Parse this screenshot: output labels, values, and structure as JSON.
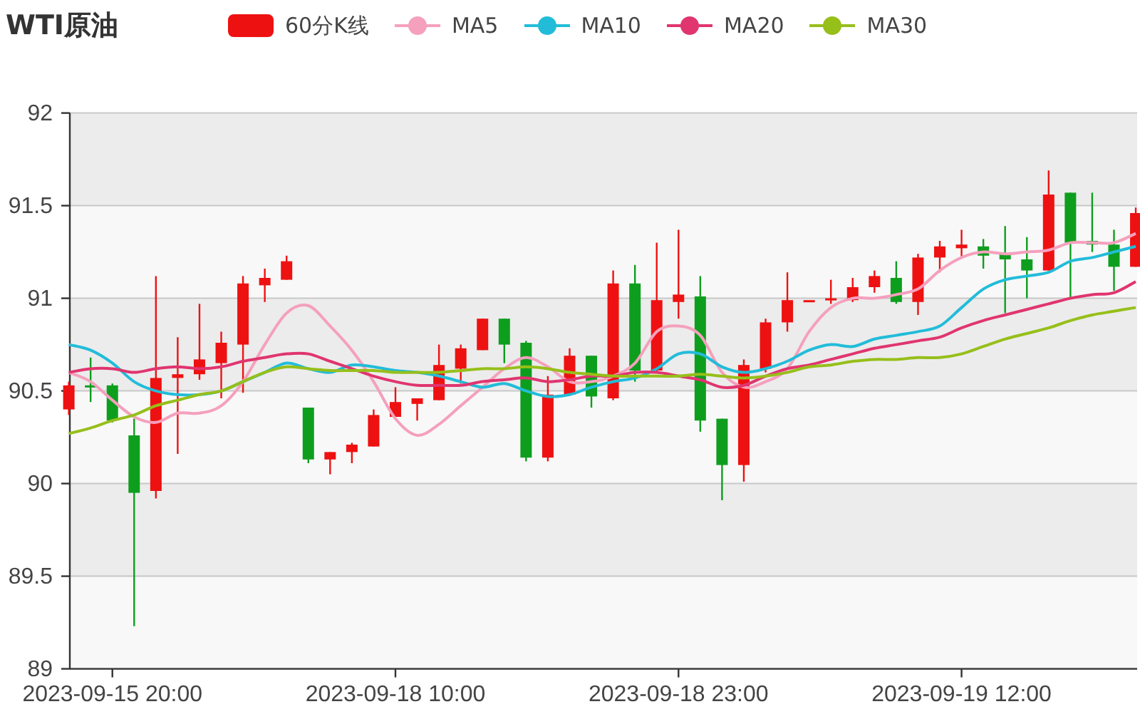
{
  "legend": {
    "candle": {
      "label": "60分K线",
      "color": "#ee1111"
    }
  },
  "chart_data": {
    "type": "candlestick",
    "title": "WTI原油",
    "grid": true,
    "ylim": [
      89,
      92
    ],
    "yticks": [
      89,
      89.5,
      90,
      90.5,
      91,
      91.5,
      92
    ],
    "categories": [
      null,
      null,
      "2023-09-15 20:00",
      null,
      null,
      null,
      null,
      null,
      null,
      null,
      null,
      null,
      null,
      null,
      null,
      "2023-09-18 10:00",
      null,
      null,
      null,
      null,
      null,
      null,
      null,
      null,
      null,
      null,
      null,
      null,
      "2023-09-18 23:00",
      null,
      null,
      null,
      null,
      null,
      null,
      null,
      null,
      null,
      null,
      null,
      null,
      "2023-09-19 12:00",
      null,
      null,
      null,
      null,
      null,
      null,
      null,
      null
    ],
    "ohlc": [
      [
        90.4,
        90.55,
        90.37,
        90.53
      ],
      [
        90.53,
        90.68,
        90.44,
        90.52
      ],
      [
        90.53,
        90.54,
        90.33,
        90.34
      ],
      [
        90.26,
        90.35,
        89.23,
        89.95
      ],
      [
        89.96,
        91.12,
        89.92,
        90.57
      ],
      [
        90.57,
        90.79,
        90.16,
        90.59
      ],
      [
        90.59,
        90.97,
        90.56,
        90.67
      ],
      [
        90.65,
        90.82,
        90.46,
        90.76
      ],
      [
        90.75,
        91.12,
        90.49,
        91.08
      ],
      [
        91.07,
        91.16,
        90.98,
        91.11
      ],
      [
        91.1,
        91.23,
        91.1,
        91.2
      ],
      [
        90.41,
        90.41,
        90.11,
        90.13
      ],
      [
        90.13,
        90.17,
        90.05,
        90.17
      ],
      [
        90.17,
        90.22,
        90.11,
        90.21
      ],
      [
        90.2,
        90.4,
        90.2,
        90.37
      ],
      [
        90.36,
        90.52,
        90.36,
        90.44
      ],
      [
        90.43,
        90.46,
        90.34,
        90.46
      ],
      [
        90.45,
        90.75,
        90.45,
        90.64
      ],
      [
        90.62,
        90.75,
        90.54,
        90.73
      ],
      [
        90.72,
        90.89,
        90.72,
        90.89
      ],
      [
        90.89,
        90.89,
        90.65,
        90.75
      ],
      [
        90.76,
        90.77,
        90.12,
        90.14
      ],
      [
        90.14,
        90.58,
        90.12,
        90.48
      ],
      [
        90.48,
        90.73,
        90.48,
        90.69
      ],
      [
        90.69,
        90.69,
        90.41,
        90.47
      ],
      [
        90.46,
        91.15,
        90.45,
        91.08
      ],
      [
        91.08,
        91.18,
        90.55,
        90.61
      ],
      [
        90.61,
        91.3,
        90.6,
        90.99
      ],
      [
        90.98,
        91.37,
        90.89,
        91.02
      ],
      [
        91.01,
        91.12,
        90.28,
        90.34
      ],
      [
        90.35,
        90.35,
        89.91,
        90.1
      ],
      [
        90.1,
        90.67,
        90.01,
        90.64
      ],
      [
        90.62,
        90.89,
        90.6,
        90.87
      ],
      [
        90.87,
        91.14,
        90.82,
        90.99
      ],
      [
        90.99,
        90.99,
        90.99,
        90.99
      ],
      [
        90.99,
        91.1,
        90.97,
        91.0
      ],
      [
        90.99,
        91.11,
        90.98,
        91.06
      ],
      [
        91.06,
        91.15,
        91.03,
        91.12
      ],
      [
        91.11,
        91.2,
        90.97,
        90.98
      ],
      [
        90.98,
        91.24,
        90.91,
        91.22
      ],
      [
        91.22,
        91.31,
        91.14,
        91.28
      ],
      [
        91.27,
        91.37,
        91.22,
        91.29
      ],
      [
        91.28,
        91.32,
        91.16,
        91.23
      ],
      [
        91.24,
        91.39,
        90.92,
        91.21
      ],
      [
        91.21,
        91.33,
        91.0,
        91.15
      ],
      [
        91.15,
        91.69,
        91.15,
        91.56
      ],
      [
        91.57,
        91.57,
        91.0,
        91.3
      ],
      [
        91.31,
        91.57,
        91.25,
        91.29
      ],
      [
        91.29,
        91.37,
        91.04,
        91.17
      ],
      [
        91.17,
        91.49,
        91.17,
        91.46
      ]
    ],
    "series": [
      {
        "name": "MA5",
        "type": "line",
        "color": "#f5a0bd",
        "values": [
          90.6,
          90.55,
          90.45,
          90.36,
          90.33,
          90.38,
          90.38,
          90.42,
          90.55,
          90.75,
          90.92,
          90.96,
          90.85,
          90.72,
          90.55,
          90.35,
          90.26,
          90.32,
          90.42,
          90.52,
          90.62,
          90.68,
          90.63,
          90.55,
          90.55,
          90.58,
          90.65,
          90.82,
          90.85,
          90.8,
          90.6,
          90.52,
          90.55,
          90.62,
          90.82,
          90.95,
          91.0,
          91.0,
          91.02,
          91.05,
          91.15,
          91.22,
          91.25,
          91.24,
          91.25,
          91.26,
          91.3,
          91.3,
          91.3,
          91.35
        ]
      },
      {
        "name": "MA10",
        "type": "line",
        "color": "#22bcd9",
        "values": [
          90.75,
          90.72,
          90.65,
          90.55,
          90.5,
          90.48,
          90.48,
          90.5,
          90.55,
          90.6,
          90.65,
          90.62,
          90.6,
          90.64,
          90.63,
          90.61,
          90.6,
          90.58,
          90.55,
          90.52,
          90.54,
          90.5,
          90.47,
          90.48,
          90.52,
          90.55,
          90.57,
          90.62,
          90.7,
          90.7,
          90.63,
          90.6,
          90.62,
          90.66,
          90.72,
          90.75,
          90.74,
          90.78,
          90.8,
          90.82,
          90.85,
          90.95,
          91.05,
          91.1,
          91.12,
          91.14,
          91.2,
          91.22,
          91.25,
          91.28
        ]
      },
      {
        "name": "MA20",
        "type": "line",
        "color": "#e0356f",
        "values": [
          90.6,
          90.62,
          90.62,
          90.6,
          90.62,
          90.63,
          90.62,
          90.63,
          90.66,
          90.68,
          90.7,
          90.7,
          90.66,
          90.62,
          90.58,
          90.55,
          90.53,
          90.53,
          90.53,
          90.55,
          90.56,
          90.57,
          90.55,
          90.56,
          90.58,
          90.58,
          90.6,
          90.6,
          90.58,
          90.56,
          90.52,
          90.53,
          90.58,
          90.62,
          90.64,
          90.67,
          90.7,
          90.73,
          90.75,
          90.77,
          90.79,
          90.84,
          90.88,
          90.91,
          90.94,
          90.97,
          91.0,
          91.02,
          91.03,
          91.09
        ]
      },
      {
        "name": "MA30",
        "type": "line",
        "color": "#96bf1a",
        "values": [
          90.27,
          90.3,
          90.34,
          90.37,
          90.42,
          90.45,
          90.48,
          90.5,
          90.55,
          90.6,
          90.63,
          90.62,
          90.61,
          90.61,
          90.61,
          90.6,
          90.6,
          90.6,
          90.61,
          90.62,
          90.62,
          90.63,
          90.62,
          90.6,
          90.59,
          90.58,
          90.58,
          90.58,
          90.58,
          90.59,
          90.58,
          90.57,
          90.58,
          90.6,
          90.63,
          90.64,
          90.66,
          90.67,
          90.67,
          90.68,
          90.68,
          90.7,
          90.74,
          90.78,
          90.81,
          90.84,
          90.88,
          90.91,
          90.93,
          90.95
        ]
      }
    ]
  }
}
